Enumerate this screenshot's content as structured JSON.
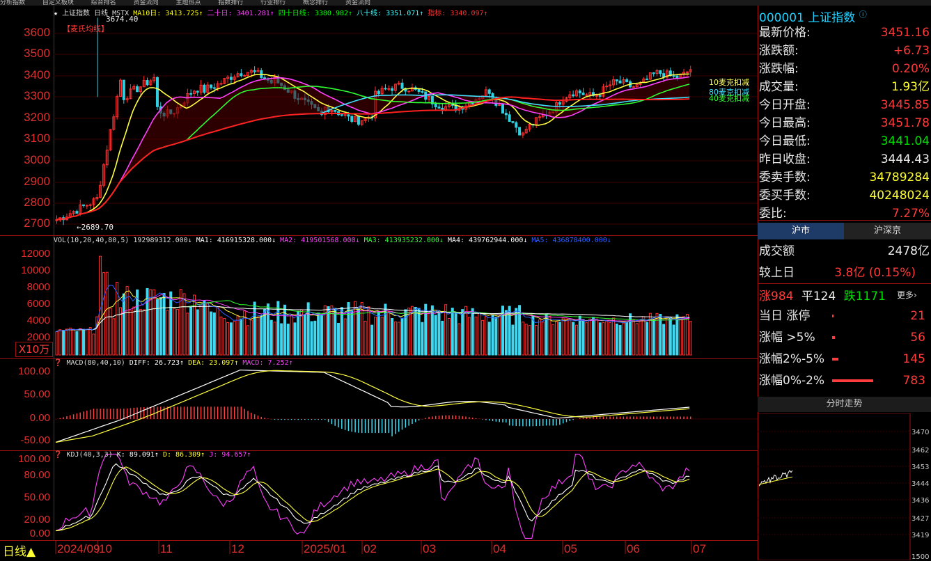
{
  "topbar": {
    "items": [
      "分析指数",
      "自定义板块",
      "综合排名",
      "资金流向",
      "主题热点",
      "指数排行",
      "行业排行",
      "概念排行",
      "资金流向"
    ]
  },
  "stock": {
    "code": "000001",
    "name": "上证指数"
  },
  "chart": {
    "title_legend": "上证指数 日线 MSTX",
    "ma_legend": [
      {
        "text": "MA10日: 3413.725↑",
        "color": "#ffff00"
      },
      {
        "text": "二十日: 3401.281↑",
        "color": "#ff40ff"
      },
      {
        "text": "四十日线: 3380.982↑",
        "color": "#00ff00"
      },
      {
        "text": "八十线: 3351.071↑",
        "color": "#40ffff"
      },
      {
        "text": "指标: 3340.097↑",
        "color": "#ff3030"
      }
    ],
    "price_axis": [
      "3600",
      "3500",
      "3400",
      "3300",
      "3200",
      "3100",
      "3000",
      "2900",
      "2800",
      "2700"
    ],
    "high_label": "3674.40",
    "low_label": "2689.70",
    "method_tag": "【麦氏均线】",
    "right_tags": [
      {
        "text": "10麦克扣减",
        "color": "#ffff66"
      },
      {
        "text": "80麦克扣减",
        "color": "#40e0ff"
      },
      {
        "text": "40麦克扣减",
        "color": "#30ff30"
      }
    ],
    "vol_legend_main": "VOL(10,20,40,80,5) 192989312.000↓",
    "vol_legend": [
      {
        "text": "MA1: 416915328.000↓",
        "color": "#ffffff"
      },
      {
        "text": "MA2: 419501568.000↓",
        "color": "#ff40ff"
      },
      {
        "text": "MA3: 413935232.000↓",
        "color": "#30ff30"
      },
      {
        "text": "MA4: 439762944.000↓",
        "color": "#ffffff"
      },
      {
        "text": "MA5: 436878400.000↓",
        "color": "#3060ff"
      }
    ],
    "vol_axis": [
      "12000",
      "10000",
      "8000",
      "6000",
      "4000",
      "2000"
    ],
    "vol_unit": "X10万",
    "macd_legend": [
      {
        "text": "MACD(80,40,10)",
        "color": "#dddddd"
      },
      {
        "text": "DIFF: 26.723↑",
        "color": "#ffffff"
      },
      {
        "text": "DEA: 23.097↑",
        "color": "#ffff33"
      },
      {
        "text": "MACD: 7.252↑",
        "color": "#ff40ff"
      }
    ],
    "macd_axis": [
      "100.00",
      "50.00",
      "0.00",
      "-50.00"
    ],
    "kdj_legend": [
      {
        "text": "KDJ(40,3,3)",
        "color": "#dddddd"
      },
      {
        "text": "K: 89.091↑",
        "color": "#ffffff"
      },
      {
        "text": "D: 86.309↑",
        "color": "#ffff33"
      },
      {
        "text": "J: 94.657↑",
        "color": "#ff40ff"
      }
    ],
    "kdj_axis": [
      "100.00",
      "80.00",
      "50.00",
      "20.00",
      "0.00"
    ],
    "period_label": "日线▲",
    "x_labels": [
      "2024/09",
      "10",
      "11",
      "12",
      "2025/01",
      "02",
      "03",
      "04",
      "05",
      "06",
      "07"
    ]
  },
  "quote": {
    "rows": [
      {
        "label": "最新价格:",
        "value": "3451.16",
        "color": "red"
      },
      {
        "label": "涨跌额:",
        "value": "+6.73",
        "color": "red"
      },
      {
        "label": "涨跌幅:",
        "value": "0.20%",
        "color": "red"
      },
      {
        "label": "成交量:",
        "value": "1.93亿",
        "color": "yellow"
      },
      {
        "label": "今日开盘:",
        "value": "3445.85",
        "color": "red"
      },
      {
        "label": "今日最高:",
        "value": "3451.78",
        "color": "red"
      },
      {
        "label": "今日最低:",
        "value": "3441.04",
        "color": "green"
      },
      {
        "label": "昨日收盘:",
        "value": "3444.43",
        "color": "white"
      },
      {
        "label": "委卖手数:",
        "value": "34789284",
        "color": "yellow"
      },
      {
        "label": "委买手数:",
        "value": "40248024",
        "color": "yellow"
      },
      {
        "label": "委比:",
        "value": "7.27%",
        "color": "red"
      }
    ]
  },
  "market_tabs": [
    "沪市",
    "沪深京"
  ],
  "market": {
    "turnover_label": "成交额",
    "turnover_value": "2478亿",
    "vs_label": "较上日",
    "vs_value": "3.8亿 (0.15%)",
    "up_label": "涨984",
    "flat_label": "平124",
    "down_label": "跌1171",
    "more_label": "更多",
    "limit_rows": [
      {
        "label": "当日 涨停",
        "value": "21",
        "bar": 0.01
      },
      {
        "label": "涨幅 >5%",
        "value": "56",
        "bar": 0.03
      },
      {
        "label": "涨幅2%-5%",
        "value": "145",
        "bar": 0.07
      },
      {
        "label": "涨幅0%-2%",
        "value": "783",
        "bar": 0.45
      }
    ]
  },
  "intraday": {
    "title": "分时走势",
    "axis": [
      "3470",
      "3462",
      "3453",
      "3444",
      "3436",
      "3427",
      "3419"
    ],
    "corner": "1500"
  }
}
